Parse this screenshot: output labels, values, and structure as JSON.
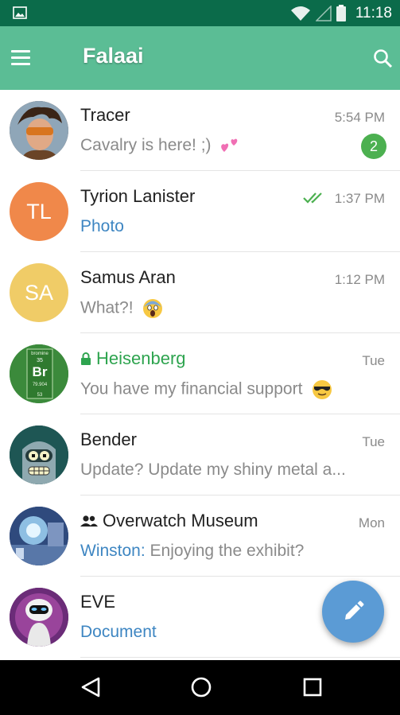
{
  "status_bar": {
    "time": "11:18"
  },
  "app_bar": {
    "title": "Falaai"
  },
  "chats": [
    {
      "name": "Tracer",
      "time": "5:54 PM",
      "message": "Cavalry is here! ;)",
      "unread": "2"
    },
    {
      "name": "Tyrion Lanister",
      "initials": "TL",
      "time": "1:37 PM",
      "message": "Photo"
    },
    {
      "name": "Samus Aran",
      "initials": "SA",
      "time": "1:12 PM",
      "message": "What?!"
    },
    {
      "name": "Heisenberg",
      "time": "Tue",
      "message": "You have my financial support",
      "tile": {
        "top": "bromine",
        "number": "35",
        "symbol": "Br",
        "mass": "79.904",
        "bottom": "53"
      }
    },
    {
      "name": "Bender",
      "time": "Tue",
      "message": "Update? Update my shiny metal a..."
    },
    {
      "name": "Overwatch Museum",
      "time": "Mon",
      "sender": "Winston:",
      "message": "Enjoying the exhibit?"
    },
    {
      "name": "EVE",
      "message": "Document"
    }
  ],
  "colors": {
    "status_bar": "#0b6b4a",
    "app_bar": "#5bbd95",
    "unread_badge": "#4cb050",
    "link_blue": "#3e86c2",
    "secret_green": "#2ea44f",
    "fab": "#5b9bd5",
    "avatar_tl": "#f0884a",
    "avatar_sa": "#f0cc67"
  }
}
